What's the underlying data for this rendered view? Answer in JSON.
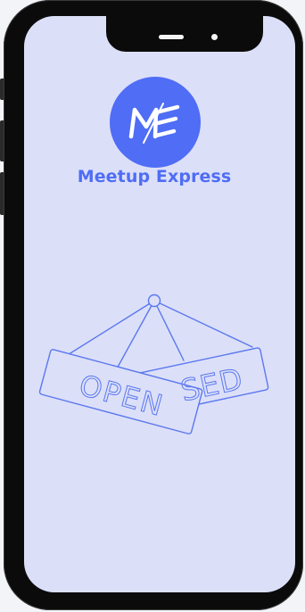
{
  "app": {
    "name": "Meetup Express",
    "logo_monogram": "ME"
  },
  "illustration": {
    "front_sign_text": "OPEN",
    "back_sign_text": "SED"
  },
  "colors": {
    "screen_background": "#dcdff8",
    "brand_blue": "#4f6df5",
    "line_art": "#5a78ef",
    "phone_body": "#0b0b0b"
  }
}
